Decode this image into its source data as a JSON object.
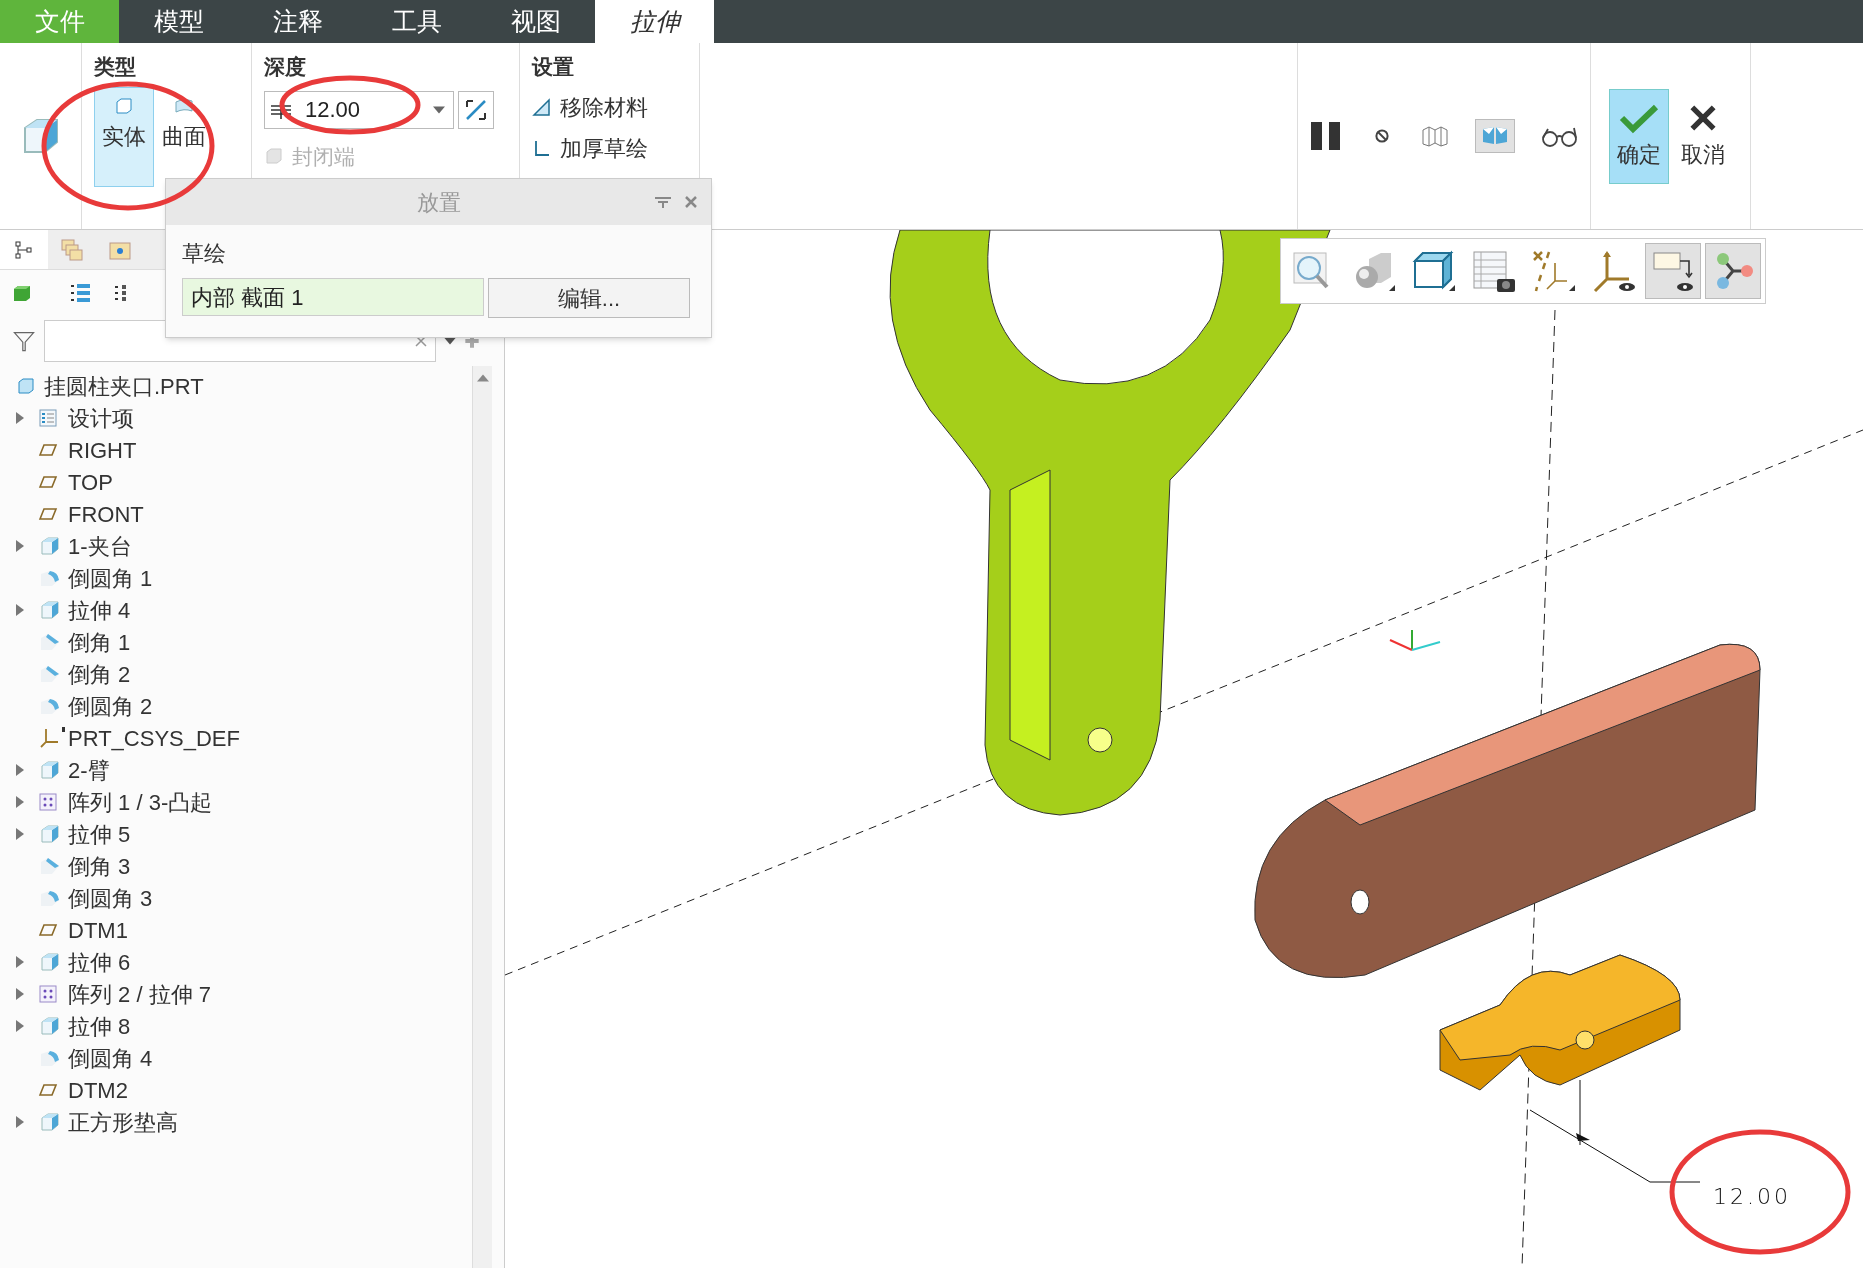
{
  "menu_tabs": [
    {
      "label": "文件",
      "kind": "file",
      "selected": false
    },
    {
      "label": "模型",
      "kind": "tab",
      "selected": false
    },
    {
      "label": "注释",
      "kind": "tab",
      "selected": false
    },
    {
      "label": "工具",
      "kind": "tab",
      "selected": false
    },
    {
      "label": "视图",
      "kind": "tab",
      "selected": false
    },
    {
      "label": "拉伸",
      "kind": "tab",
      "selected": true
    }
  ],
  "ribbon": {
    "type_group": {
      "title": "类型",
      "options": [
        {
          "label": "实体",
          "kind": "solid",
          "selected": true
        },
        {
          "label": "曲面",
          "kind": "surface",
          "selected": false
        }
      ]
    },
    "depth_group": {
      "title": "深度",
      "value": "12.00",
      "capped_end": {
        "label": "封闭端",
        "disabled": true
      }
    },
    "settings_group": {
      "title": "设置",
      "items": [
        {
          "label": "移除材料",
          "kind": "remove"
        },
        {
          "label": "加厚草绘",
          "kind": "thicken"
        }
      ]
    },
    "tools": [
      {
        "kind": "pause",
        "selected": false
      },
      {
        "kind": "no-preview",
        "selected": false
      },
      {
        "kind": "verify",
        "selected": false
      },
      {
        "kind": "preview",
        "selected": true
      },
      {
        "kind": "glasses",
        "selected": false
      }
    ],
    "confirm": {
      "label": "确定",
      "selected": true
    },
    "cancel": {
      "label": "取消",
      "selected": false
    }
  },
  "placement_panel": {
    "title": "放置",
    "section_label": "草绘",
    "sketch": "内部 截面 1",
    "edit_button": "编辑..."
  },
  "model_tree": {
    "root": "挂圆柱夹口.PRT",
    "items": [
      {
        "label": "设计项",
        "kind": "design",
        "expander": true
      },
      {
        "label": "RIGHT",
        "kind": "plane",
        "expander": false
      },
      {
        "label": "TOP",
        "kind": "plane",
        "expander": false
      },
      {
        "label": "FRONT",
        "kind": "plane",
        "expander": false
      },
      {
        "label": "1-夹台",
        "kind": "extrude",
        "expander": true
      },
      {
        "label": "倒圆角 1",
        "kind": "round",
        "expander": false
      },
      {
        "label": "拉伸 4",
        "kind": "extrude",
        "expander": true
      },
      {
        "label": "倒角 1",
        "kind": "chamfer",
        "expander": false
      },
      {
        "label": "倒角 2",
        "kind": "chamfer",
        "expander": false
      },
      {
        "label": "倒圆角 2",
        "kind": "round",
        "expander": false
      },
      {
        "label": "PRT_CSYS_DEF",
        "kind": "csys",
        "expander": false
      },
      {
        "label": "2-臂",
        "kind": "extrude",
        "expander": true
      },
      {
        "label": "阵列 1 / 3-凸起",
        "kind": "pattern",
        "expander": true
      },
      {
        "label": "拉伸 5",
        "kind": "extrude",
        "expander": true
      },
      {
        "label": "倒角 3",
        "kind": "chamfer",
        "expander": false
      },
      {
        "label": "倒圆角 3",
        "kind": "round",
        "expander": false
      },
      {
        "label": "DTM1",
        "kind": "plane",
        "expander": false
      },
      {
        "label": "拉伸 6",
        "kind": "extrude",
        "expander": true
      },
      {
        "label": "阵列 2 / 拉伸 7",
        "kind": "pattern",
        "expander": true
      },
      {
        "label": "拉伸 8",
        "kind": "extrude",
        "expander": true
      },
      {
        "label": "倒圆角 4",
        "kind": "round",
        "expander": false
      },
      {
        "label": "DTM2",
        "kind": "plane",
        "expander": false
      },
      {
        "label": "正方形垫高",
        "kind": "extrude",
        "expander": true
      }
    ]
  },
  "view_toolbar": [
    {
      "kind": "zoom",
      "selected": false
    },
    {
      "kind": "display-style",
      "selected": false
    },
    {
      "kind": "saved-views",
      "selected": false
    },
    {
      "kind": "view-manager",
      "selected": false
    },
    {
      "kind": "datum-display",
      "selected": false
    },
    {
      "kind": "csys-display",
      "selected": false
    },
    {
      "kind": "annotation-display",
      "selected": true
    },
    {
      "kind": "feature-tree",
      "selected": true
    }
  ],
  "dimension": "12.00"
}
